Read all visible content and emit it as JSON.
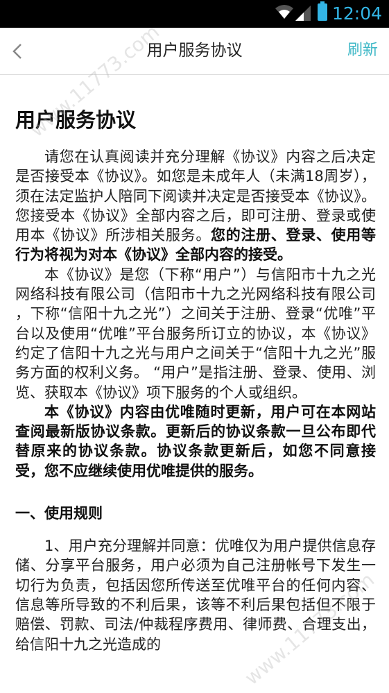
{
  "status_bar": {
    "time": "12:04"
  },
  "nav": {
    "title": "用户服务协议",
    "refresh_label": "刷新"
  },
  "document": {
    "title": "用户服务协议",
    "p1_normal": "请您在认真阅读并充分理解《协议》内容之后决定是否接受本《协议》。如您是未成年人（未满18周岁），须在法定监护人陪同下阅读并决定是否接受本《协议》。您接受本《协议》全部内容之后，即可注册、登录或使用本《协议》所涉相关服务。",
    "p1_bold": "您的注册、登录、使用等行为将视为对本《协议》全部内容的接受。",
    "p2": "本《协议》是您（下称“用户”）与信阳市十九之光网络科技有限公司（信阳市十九之光网络科技有限公司 ，下称“信阳十九之光”）之间关于注册、登录“优唯”平台以及使用“优唯”平台服务所订立的协议，本《协议》约定了信阳十九之光与用户之间关于“信阳十九之光”服务方面的权利义务。 “用户”是指注册、登录、使用、浏览、获取本《协议》项下服务的个人或组织。",
    "p3": "本《协议》内容由优唯随时更新，用户可在本网站查阅最新版协议条款。更新后的协议条款一旦公布即代替原来的协议条款。协议条款更新后，如您不同意接受，您不应继续使用优唯提供的服务。",
    "section1_title": "一、使用规则",
    "section1_p1": "1、用户充分理解并同意：优唯仅为用户提供信息存储、分享平台服务，用户必须为自己注册帐号下发生一切行为负责，包括因您所传送至优唯平台的任何内容、信息等所导致的不利后果，该等不利后果包括但不限于赔偿、罚款、司法/仲裁程序费用、律师费、合理支出，给信阳十九之光造成的"
  },
  "watermark": {
    "text": "www.11773.com"
  }
}
